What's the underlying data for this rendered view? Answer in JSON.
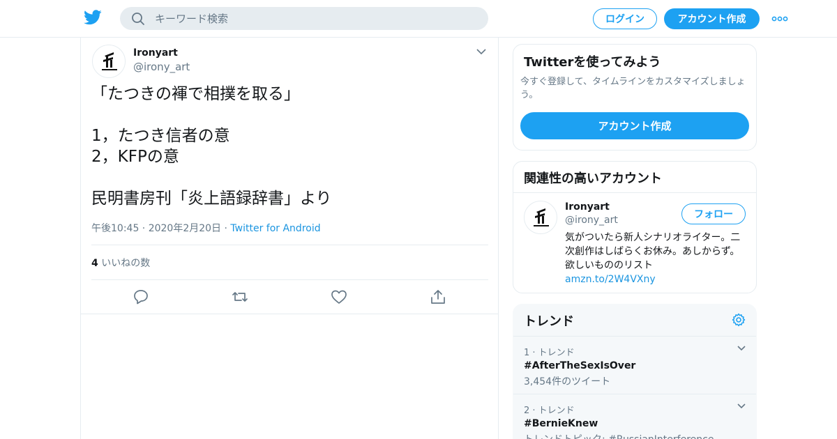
{
  "header": {
    "search_placeholder": "キーワード検索",
    "login_label": "ログイン",
    "signup_label": "アカウント作成",
    "logo_icon": "twitter-bird-icon",
    "accent_color": "#1da1f2"
  },
  "tweet": {
    "user_name": "Ironyart",
    "user_handle": "@irony_art",
    "text": "「たつきの褌で相撲を取る」\n\n1，たつき信者の意\n2，KFPの意\n\n民明書房刊「炎上語録辞書」より",
    "timestamp": "午後10:45 · 2020年2月20日 ·",
    "source": "Twitter for Android",
    "like_count": "4",
    "like_label": "いいねの数"
  },
  "sidebar": {
    "signup_card": {
      "title": "Twitterを使ってみよう",
      "description": "今すぐ登録して、タイムラインをカスタマイズしましょう。",
      "button_label": "アカウント作成"
    },
    "related_card": {
      "title": "関連性の高いアカウント",
      "account_name": "Ironyart",
      "account_handle": "@irony_art",
      "follow_label": "フォロー",
      "bio": "気がついたら新人シナリオライター。二次創作はしばらくお休み。あしからず。 欲しいもののリスト",
      "bio_link": "amzn.to/2W4VXny"
    },
    "trends_card": {
      "title": "トレンド",
      "items": [
        {
          "rank": "1 · トレンド",
          "tag": "#AfterTheSexIsOver",
          "meta": "3,454件のツイート"
        },
        {
          "rank": "2 · トレンド",
          "tag": "#BernieKnew",
          "meta": "トレンドトピック: #RussianInterference"
        }
      ]
    }
  }
}
